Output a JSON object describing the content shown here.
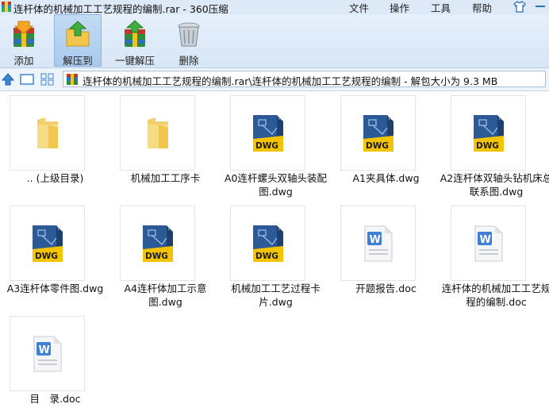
{
  "window": {
    "title": "连杆体的机械加工工艺规程的编制.rar - 360压缩",
    "menu": [
      "文件",
      "操作",
      "工具",
      "帮助"
    ]
  },
  "toolbar": {
    "buttons": [
      {
        "label": "添加",
        "icon": "add-icon"
      },
      {
        "label": "解压到",
        "icon": "extract-to-icon"
      },
      {
        "label": "一键解压",
        "icon": "one-click-extract-icon"
      },
      {
        "label": "删除",
        "icon": "delete-icon"
      }
    ]
  },
  "address": {
    "path": "连杆体的机械加工工艺规程的编制.rar\\连杆体的机械加工工艺规程的编制 - 解包大小为 9.3 MB"
  },
  "files": [
    {
      "name": ".. (上级目录)",
      "type": "folder"
    },
    {
      "name": "机械加工工序卡",
      "type": "folder"
    },
    {
      "name": "A0连杆螺头双轴头装配图.dwg",
      "type": "dwg"
    },
    {
      "name": "A1夹具体.dwg",
      "type": "dwg"
    },
    {
      "name": "A2连杆体双轴头钻机床总联系图.dwg",
      "type": "dwg"
    },
    {
      "name": "A3连杆体零件图.dwg",
      "type": "dwg"
    },
    {
      "name": "A4连杆体加工示意图.dwg",
      "type": "dwg"
    },
    {
      "name": "机械加工工艺过程卡片.dwg",
      "type": "dwg"
    },
    {
      "name": "开题报告.doc",
      "type": "doc"
    },
    {
      "name": "连杆体的机械加工工艺规程的编制.doc",
      "type": "doc"
    },
    {
      "name": "目　录.doc",
      "type": "doc"
    }
  ],
  "colors": {
    "accent": "#2f6fb7",
    "toolbar_bg": "#dde9f6",
    "dwg_yellow": "#f5c400",
    "folder": "#f3cf6b"
  }
}
